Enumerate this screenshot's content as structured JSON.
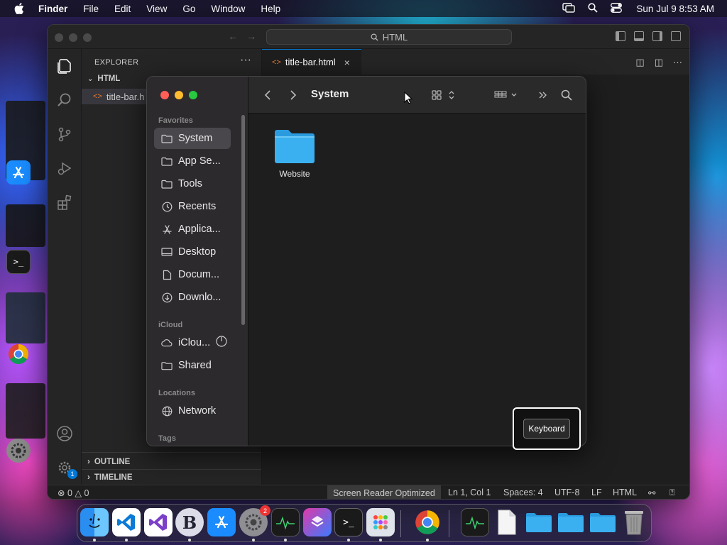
{
  "menubar": {
    "app_name": "Finder",
    "items": [
      "File",
      "Edit",
      "View",
      "Go",
      "Window",
      "Help"
    ],
    "clock": "Sun Jul 9  8:53 AM",
    "icons": [
      "screen-mirroring-icon",
      "spotlight-search-icon",
      "control-center-icon"
    ]
  },
  "vscode": {
    "search_label": "HTML",
    "explorer_header": "EXPLORER",
    "folder": "HTML",
    "file": "title-bar.h",
    "tab_label": "title-bar.html",
    "outline_label": "OUTLINE",
    "timeline_label": "TIMELINE",
    "accounts_badge": "1",
    "status": {
      "errors": "0",
      "warnings": "0",
      "screen_reader": "Screen Reader Optimized",
      "position": "Ln 1, Col 1",
      "spaces": "Spaces: 4",
      "encoding": "UTF-8",
      "eol": "LF",
      "language": "HTML"
    }
  },
  "finder": {
    "title": "System",
    "favorites_label": "Favorites",
    "favorites": [
      "System",
      "App Se...",
      "Tools",
      "Recents",
      "Applica...",
      "Desktop",
      "Docum...",
      "Downlo..."
    ],
    "icloud_label": "iCloud",
    "icloud_items": [
      "iClou...",
      "Shared"
    ],
    "locations_label": "Locations",
    "locations": [
      "Network"
    ],
    "tags_label": "Tags",
    "folder_name": "Website"
  },
  "keyboard_popup": {
    "label": "Keyboard"
  },
  "dock": {
    "apps": [
      "Finder",
      "Visual Studio Code",
      "Visual Studio",
      "BBEdit",
      "App Store",
      "System Settings",
      "Activity Monitor",
      "Shortcuts",
      "Terminal",
      "Launchpad",
      "Google Chrome",
      "Activity Monitor Doc",
      "Document",
      "Folder",
      "Folder",
      "Folder",
      "Trash"
    ],
    "settings_badge": "2"
  },
  "colors": {
    "accent": "#0078d4",
    "folder_blue": "#3bb0f0",
    "close": "#ff5f57",
    "minimize": "#febc2e",
    "zoom": "#28c840"
  }
}
